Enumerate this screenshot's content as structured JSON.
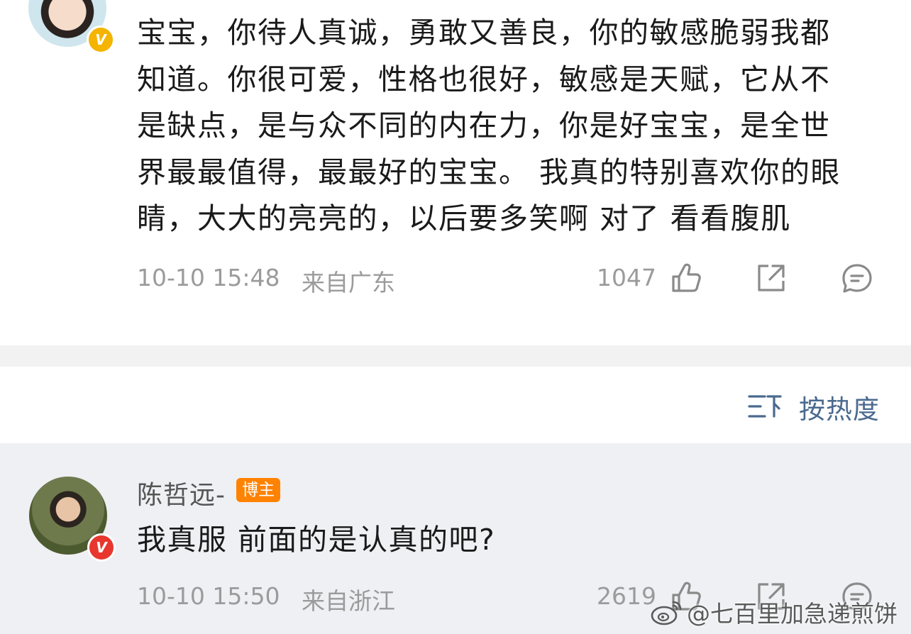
{
  "post1": {
    "text": "宝宝，你待人真诚，勇敢又善良，你的敏感脆弱我都知道。你很可爱，性格也很好，敏感是天赋，它从不是缺点，是与众不同的内在力，你是好宝宝，是全世界最最值得，最最好的宝宝。 我真的特别喜欢你的眼睛，大大的亮亮的，以后要多笑啊 对了 看看腹肌",
    "lines": [
      "宝宝，你待人真诚，勇敢又善良，你的敏感脆弱我都",
      "知道。你很可爱，性格也很好，敏感是天赋，它从不",
      "是缺点，是与众不同的内在力，你是好宝宝，是全世",
      "界最最值得，最最好的宝宝。 我真的特别喜欢你的眼",
      "睛，大大的亮亮的，以后要多笑啊 对了 看看腹肌"
    ],
    "time": "10-10 15:48",
    "location": "来自广东",
    "likes": "1047",
    "verified_badge": "V",
    "verified_color": "#f4b400"
  },
  "sort": {
    "label": "按热度",
    "icon": "sort-icon"
  },
  "post2": {
    "username": "陈哲远-",
    "badge": "博主",
    "text": "我真服 前面的是认真的吧?",
    "time": "10-10 15:50",
    "location": "来自浙江",
    "likes": "2619",
    "verified_badge": "V",
    "verified_color": "#e8372e"
  },
  "watermark": {
    "text": "@七百里加急递煎饼",
    "icon": "weibo-logo-icon"
  },
  "colors": {
    "text": "#1a1a1a",
    "meta": "#9b9b9b",
    "sort_accent": "#4a6a8f",
    "badge_orange": "#ff8200",
    "post2_background": "#eef0f4",
    "divider": "#f2f2f2"
  }
}
